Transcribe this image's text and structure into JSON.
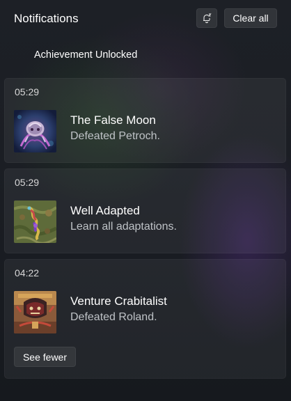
{
  "header": {
    "title": "Notifications",
    "dnd_icon": "snooze-bell-icon",
    "clear_all_label": "Clear all"
  },
  "group": {
    "title": "Achievement Unlocked"
  },
  "notifications": [
    {
      "time": "05:29",
      "title": "The False Moon",
      "description": "Defeated Petroch.",
      "thumbnail": "false-moon-achievement-art"
    },
    {
      "time": "05:29",
      "title": "Well Adapted",
      "description": "Learn all adaptations.",
      "thumbnail": "well-adapted-achievement-art"
    },
    {
      "time": "04:22",
      "title": "Venture Crabitalist",
      "description": "Defeated Roland.",
      "thumbnail": "venture-crabitalist-achievement-art"
    }
  ],
  "see_fewer_label": "See fewer"
}
